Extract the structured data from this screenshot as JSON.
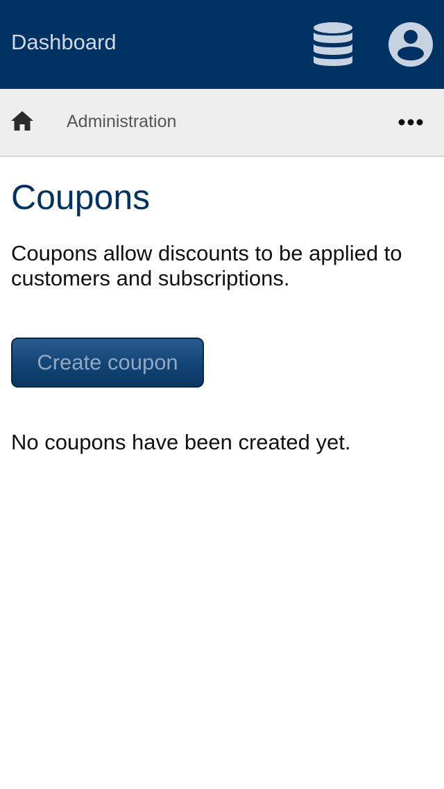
{
  "header": {
    "title": "Dashboard",
    "db_icon": "database-icon",
    "account_icon": "account-circle-icon",
    "icon_color": "#c7d3e0",
    "background": "#003263"
  },
  "breadcrumb": {
    "home_icon": "home-icon",
    "current": "Administration",
    "more_icon": "more-horizontal-icon"
  },
  "main": {
    "title": "Coupons",
    "description": "Coupons allow discounts to be applied to customers and subscriptions.",
    "create_button_label": "Create coupon",
    "empty_message": "No coupons have been created yet."
  }
}
